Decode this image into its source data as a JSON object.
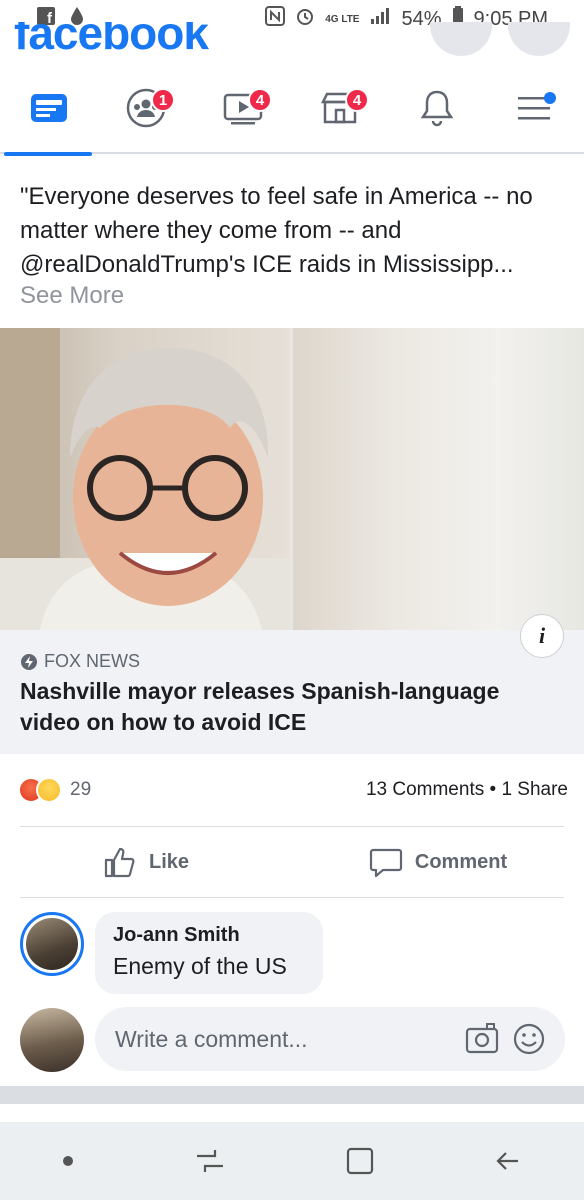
{
  "status_bar": {
    "battery": "54%",
    "time": "9:05 PM",
    "network": "4G LTE"
  },
  "header": {
    "logo_text": "facebook"
  },
  "nav": {
    "tabs": [
      {
        "name": "news-feed",
        "badge": ""
      },
      {
        "name": "groups",
        "badge": "1"
      },
      {
        "name": "watch",
        "badge": "4"
      },
      {
        "name": "marketplace",
        "badge": "4"
      },
      {
        "name": "notifications",
        "badge": ""
      },
      {
        "name": "menu",
        "badge": ""
      }
    ]
  },
  "post": {
    "text": "\"Everyone deserves to feel safe in America -- no matter where they come from -- and @realDonaldTrump's ICE raids in Mississipp...",
    "see_more": "See More",
    "link": {
      "source": "FOX NEWS",
      "headline": "Nashville mayor releases Spanish-language video on how to avoid ICE",
      "info_label": "i"
    },
    "reactions": {
      "count": "29",
      "comments": "13 Comments",
      "shares": "1 Share",
      "separator": "•"
    },
    "actions": {
      "like": "Like",
      "comment": "Comment"
    }
  },
  "comments": [
    {
      "author": "Jo-ann Smith",
      "text": "Enemy of the US"
    }
  ],
  "composer": {
    "placeholder": "Write a comment..."
  },
  "colors": {
    "brand": "#1877f2",
    "badge": "#f02849",
    "muted": "#606770"
  }
}
